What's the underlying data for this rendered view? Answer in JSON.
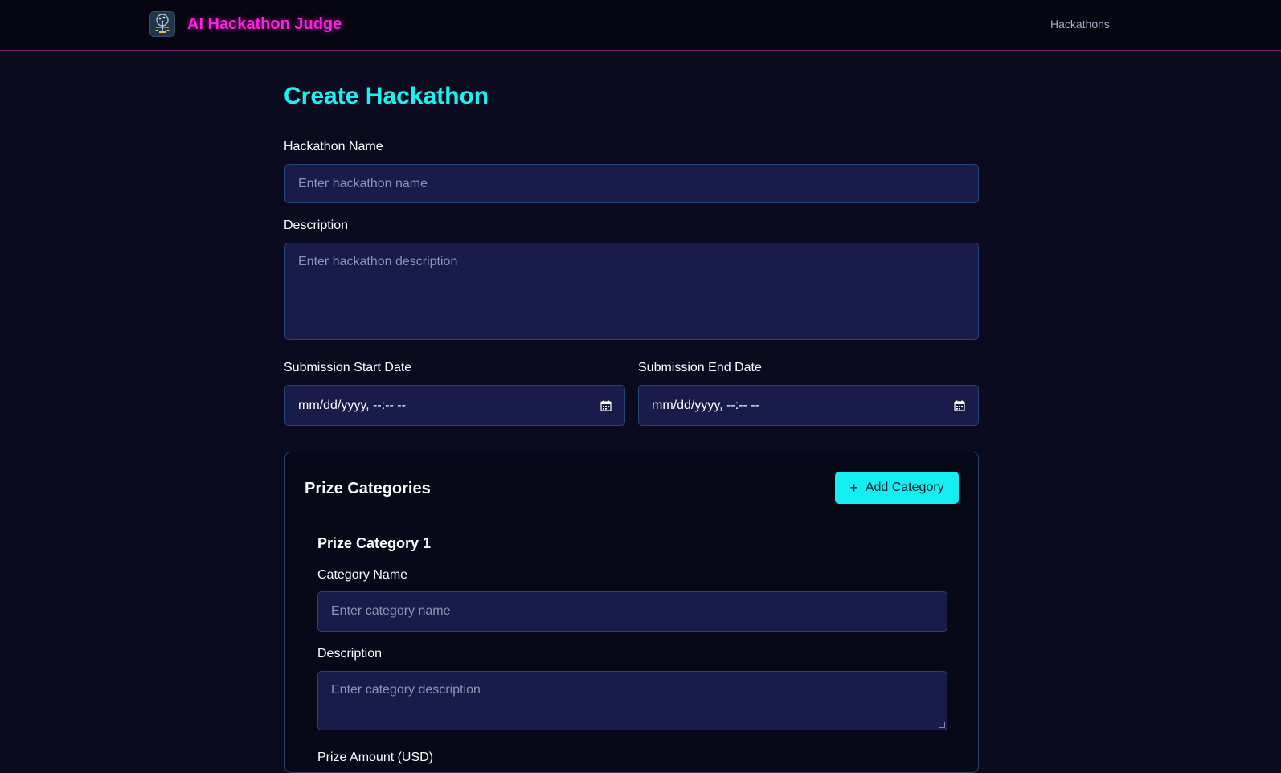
{
  "navbar": {
    "brand_title": "AI Hackathon Judge",
    "logo_icon": "balance-tree-logo-icon",
    "nav_link": "Hackathons"
  },
  "form": {
    "title": "Create Hackathon",
    "name": {
      "label": "Hackathon Name",
      "placeholder": "Enter hackathon name",
      "value": ""
    },
    "description": {
      "label": "Description",
      "placeholder": "Enter hackathon description",
      "value": ""
    },
    "start_date": {
      "label": "Submission Start Date",
      "display": "mm/dd/yyyy, --:-- --",
      "icon": "calendar-icon"
    },
    "end_date": {
      "label": "Submission End Date",
      "display": "mm/dd/yyyy, --:-- --",
      "icon": "calendar-icon"
    }
  },
  "prize_categories": {
    "title": "Prize Categories",
    "add_button_label": "Add Category",
    "add_button_icon": "plus-icon",
    "items": [
      {
        "heading": "Prize Category 1",
        "name": {
          "label": "Category Name",
          "placeholder": "Enter category name",
          "value": ""
        },
        "description": {
          "label": "Description",
          "placeholder": "Enter category description",
          "value": ""
        },
        "amount": {
          "label": "Prize Amount (USD)"
        }
      }
    ]
  },
  "colors": {
    "background": "#0a0b1e",
    "brand": "#ff1ee1",
    "accent": "#1af2f2",
    "field_bg": "#191b4a",
    "field_border": "#254577"
  }
}
